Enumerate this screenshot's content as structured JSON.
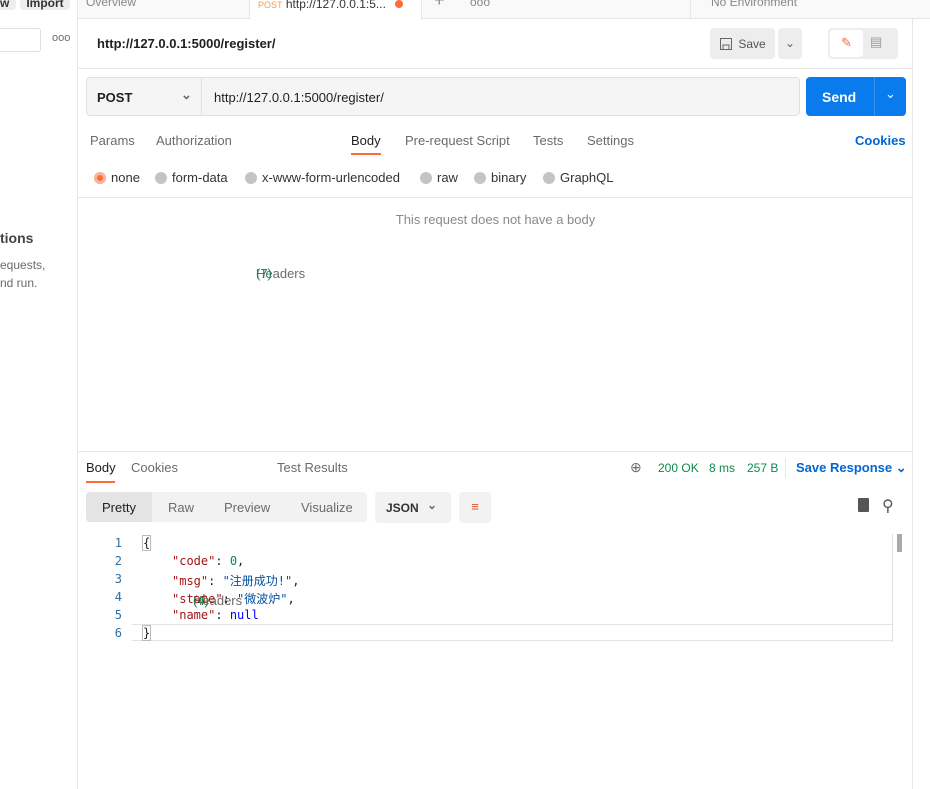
{
  "sidebar": {
    "new_label": "w",
    "import_label": "Import",
    "more_icon": "ellipsis",
    "heading": "tions",
    "text_line1": "equests,",
    "text_line2": "nd run."
  },
  "tabs": {
    "overview": "Overview",
    "active_method": "POST",
    "active_url": "http://127.0.0.1:5...",
    "unsaved_color": "#ff6c37",
    "environment": "No Environment"
  },
  "request": {
    "title": "http://127.0.0.1:5000/register/",
    "save_label": "Save",
    "method": "POST",
    "url": "http://127.0.0.1:5000/register/",
    "send_label": "Send"
  },
  "req_tabs": [
    {
      "label": "Params"
    },
    {
      "label": "Authorization"
    },
    {
      "label": "Headers",
      "count": "(7)"
    },
    {
      "label": "Body"
    },
    {
      "label": "Pre-request Script"
    },
    {
      "label": "Tests"
    },
    {
      "label": "Settings"
    }
  ],
  "cookies_label": "Cookies",
  "body_types": [
    "none",
    "form-data",
    "x-www-form-urlencoded",
    "raw",
    "binary",
    "GraphQL"
  ],
  "selected_body_type": "none",
  "no_body_text": "This request does not have a body",
  "response": {
    "tabs": [
      {
        "label": "Body"
      },
      {
        "label": "Cookies"
      },
      {
        "label": "Headers",
        "count": "(4)"
      },
      {
        "label": "Test Results"
      }
    ],
    "status": "200 OK",
    "time": "8 ms",
    "size": "257 B",
    "save_response": "Save Response",
    "views": [
      "Pretty",
      "Raw",
      "Preview",
      "Visualize"
    ],
    "format": "JSON",
    "lines": [
      "1",
      "2",
      "3",
      "4",
      "5",
      "6"
    ],
    "code": {
      "open": "{",
      "code_key": "\"code\"",
      "code_val": "0",
      "msg_key": "\"msg\"",
      "msg_val": "\"注册成功!\"",
      "state_key": "\"state\"",
      "state_val": "\"微波炉\"",
      "name_key": "\"name\"",
      "name_val": "null",
      "close": "}"
    }
  },
  "colors": {
    "accent": "#ff6c37",
    "send": "#097bed",
    "link": "#0265d2",
    "status": "#0c8a4f"
  }
}
